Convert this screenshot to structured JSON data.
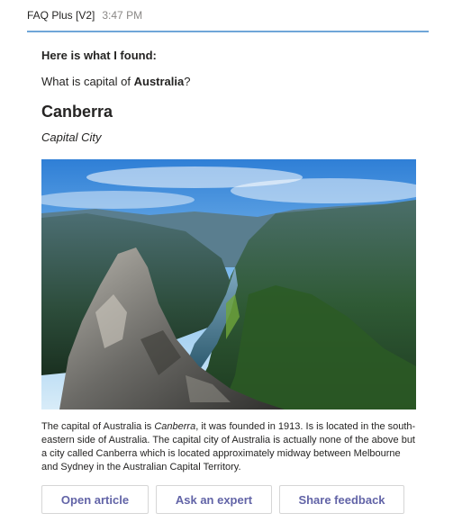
{
  "message": {
    "sender": "FAQ Plus [V2]",
    "time": "3:47 PM"
  },
  "card": {
    "intro": "Here is what I found:",
    "question_prefix": "What is capital of ",
    "question_bold": "Australia",
    "question_suffix": "?",
    "answer_title": "Canberra",
    "answer_subtitle": "Capital City",
    "image_alt": "fjord-landscape",
    "body_part1": "The capital of Australia is ",
    "body_italic": "Canberra",
    "body_part2": ", it was founded in 1913. Is is located in the south-eastern side of Australia. The capital city of Australia is actually none of the above but a city called Canberra which is located approximately midway between Melbourne and Sydney in the Australian Capital Territory."
  },
  "actions": {
    "open_article": "Open article",
    "ask_expert": "Ask an expert",
    "share_feedback": "Share feedback"
  },
  "colors": {
    "accent": "#6264a7",
    "header_line": "#6fa6d8"
  }
}
